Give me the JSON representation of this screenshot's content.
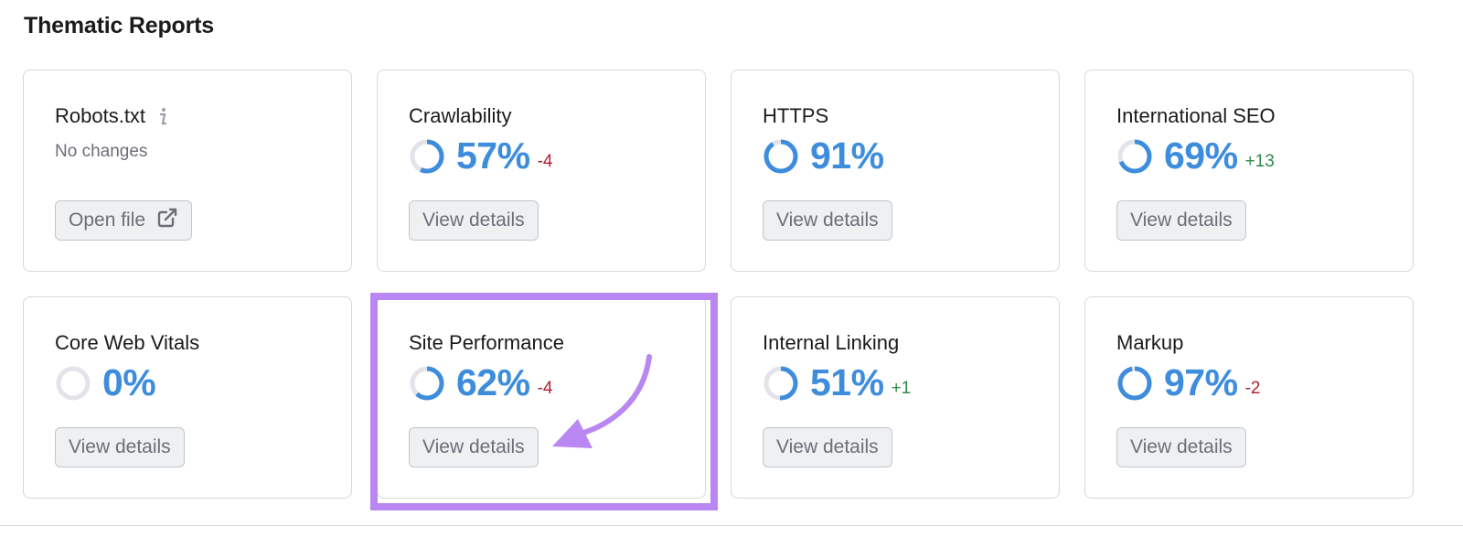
{
  "section": {
    "title": "Thematic Reports"
  },
  "colors": {
    "accent_blue": "#3e8ddc",
    "donut_track": "#e2e4ea",
    "negative": "#b32034",
    "positive": "#2f8a4b",
    "highlight": "#b987f2"
  },
  "cards": [
    {
      "title": "Robots.txt",
      "icon": "info-icon",
      "subtitle": "No changes",
      "button": "Open file",
      "button_icon": "external-link-icon"
    },
    {
      "title": "Crawlability",
      "percent": "57%",
      "progress": 0.57,
      "delta": "-4",
      "delta_type": "neg",
      "button": "View details"
    },
    {
      "title": "HTTPS",
      "percent": "91%",
      "progress": 0.91,
      "delta": "",
      "delta_type": "",
      "button": "View details"
    },
    {
      "title": "International SEO",
      "percent": "69%",
      "progress": 0.69,
      "delta": "+13",
      "delta_type": "pos",
      "button": "View details"
    },
    {
      "title": "Core Web Vitals",
      "percent": "0%",
      "progress": 0,
      "delta": "",
      "delta_type": "",
      "button": "View details"
    },
    {
      "title": "Site Performance",
      "percent": "62%",
      "progress": 0.62,
      "delta": "-4",
      "delta_type": "neg",
      "button": "View details",
      "highlighted": true
    },
    {
      "title": "Internal Linking",
      "percent": "51%",
      "progress": 0.51,
      "delta": "+1",
      "delta_type": "pos",
      "button": "View details"
    },
    {
      "title": "Markup",
      "percent": "97%",
      "progress": 0.97,
      "delta": "-2",
      "delta_type": "neg",
      "button": "View details"
    }
  ]
}
